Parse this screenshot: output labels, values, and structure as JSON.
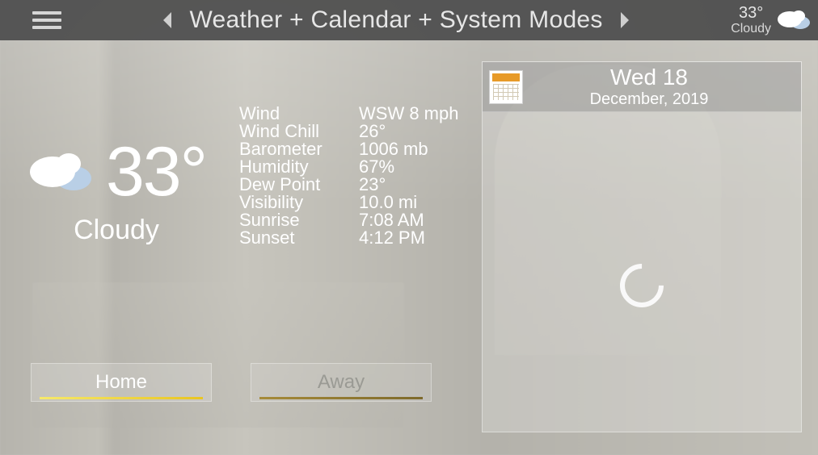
{
  "header": {
    "title": "Weather + Calendar + System Modes",
    "temp": "33°",
    "condition": "Cloudy"
  },
  "weather": {
    "temp": "33°",
    "condition": "Cloudy",
    "details": [
      {
        "label": "Wind",
        "value": "WSW 8 mph"
      },
      {
        "label": "Wind Chill",
        "value": "26°"
      },
      {
        "label": "Barometer",
        "value": "1006 mb"
      },
      {
        "label": "Humidity",
        "value": "67%"
      },
      {
        "label": "Dew Point",
        "value": "23°"
      },
      {
        "label": "Visibility",
        "value": "10.0 mi"
      },
      {
        "label": "Sunrise",
        "value": "7:08 AM"
      },
      {
        "label": "Sunset",
        "value": "4:12 PM"
      }
    ]
  },
  "modes": {
    "home": "Home",
    "away": "Away"
  },
  "calendar": {
    "day_label": "Wed 18",
    "month_label": "December, 2019"
  }
}
